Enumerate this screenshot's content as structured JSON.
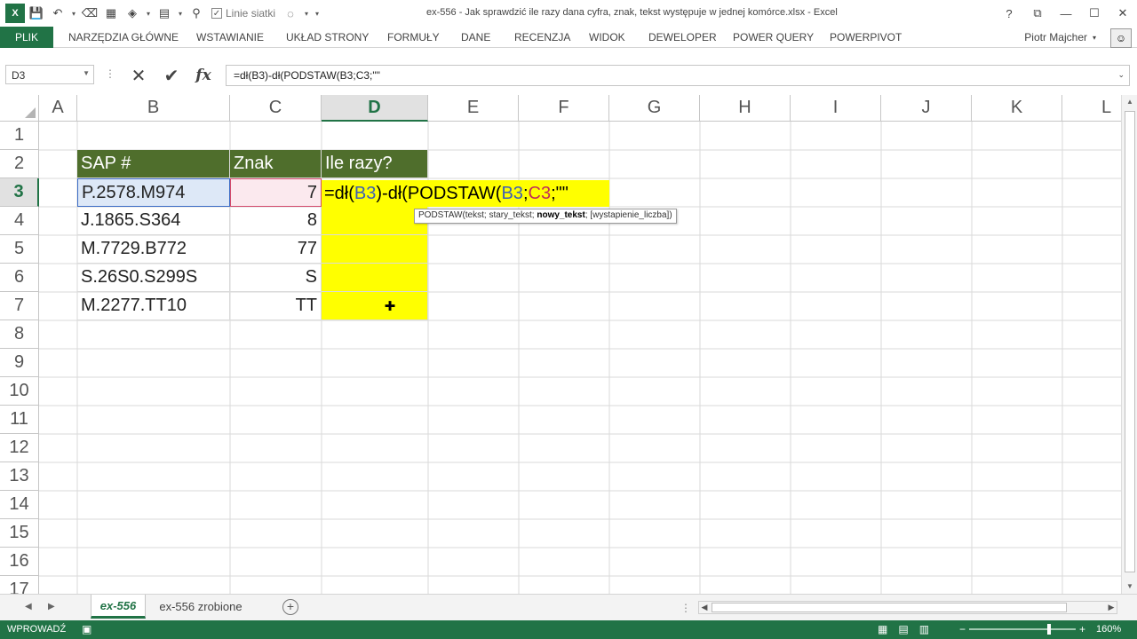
{
  "titlebar": {
    "title": "ex-556 - Jak sprawdzić ile razy dana cyfra, znak, tekst występuje w jednej komórce.xlsx - Excel",
    "gridlines_label": "Linie siatki",
    "help": "?",
    "restore": "⧉",
    "minimize": "—",
    "maximize": "☐",
    "close": "✕"
  },
  "ribbon": {
    "file": "PLIK",
    "tabs": [
      "NARZĘDZIA GŁÓWNE",
      "WSTAWIANIE",
      "UKŁAD STRONY",
      "FORMUŁY",
      "DANE",
      "RECENZJA",
      "WIDOK",
      "DEWELOPER",
      "POWER QUERY",
      "POWERPIVOT"
    ],
    "user": "Piotr Majcher"
  },
  "formula_bar": {
    "name_box": "D3",
    "formula": "=dł(B3)-dł(PODSTAW(B3;C3;\"\"",
    "cancel": "✕",
    "enter": "✔",
    "fx": "fx"
  },
  "grid": {
    "columns": [
      "A",
      "B",
      "C",
      "D",
      "E",
      "F",
      "G",
      "H",
      "I",
      "J",
      "K",
      "L"
    ],
    "active_column": "D",
    "rows": [
      "1",
      "2",
      "3",
      "4",
      "5",
      "6",
      "7",
      "8",
      "9",
      "10",
      "11",
      "12",
      "13",
      "14",
      "15",
      "16",
      "17"
    ],
    "active_row": "3",
    "headers": {
      "b": "SAP #",
      "c": "Znak",
      "d": "Ile razy?"
    },
    "data": [
      {
        "b": "P.2578.M974",
        "c": "7"
      },
      {
        "b": "J.1865.S364",
        "c": "8"
      },
      {
        "b": "M.7729.B772",
        "c": "77"
      },
      {
        "b": "S.26S0.S299S",
        "c": "S"
      },
      {
        "b": "M.2277.TT10",
        "c": "TT"
      }
    ],
    "editor": {
      "p1": "=dł(",
      "ref1": "B3",
      "p2": ")-dł(PODSTAW(",
      "ref2": "B3",
      "sep": ";",
      "ref3": "C3",
      "p3": ";\"\""
    },
    "tooltip": {
      "fn": "PODSTAW(tekst; stary_tekst; ",
      "bold": "nowy_tekst",
      "rest": "; [wystapienie_liczba])"
    }
  },
  "sheets": {
    "tabs": [
      "ex-556",
      "ex-556 zrobione"
    ],
    "active": "ex-556"
  },
  "status": {
    "mode": "WPROWADŹ",
    "zoom_minus": "−",
    "zoom_plus": "+",
    "zoom": "160%"
  },
  "colors": {
    "accent": "#217346",
    "header_fill": "#4f6e2c",
    "highlight": "#ffff00",
    "ref_b3": "#3c5fb6",
    "ref_c3": "#c02c57"
  }
}
